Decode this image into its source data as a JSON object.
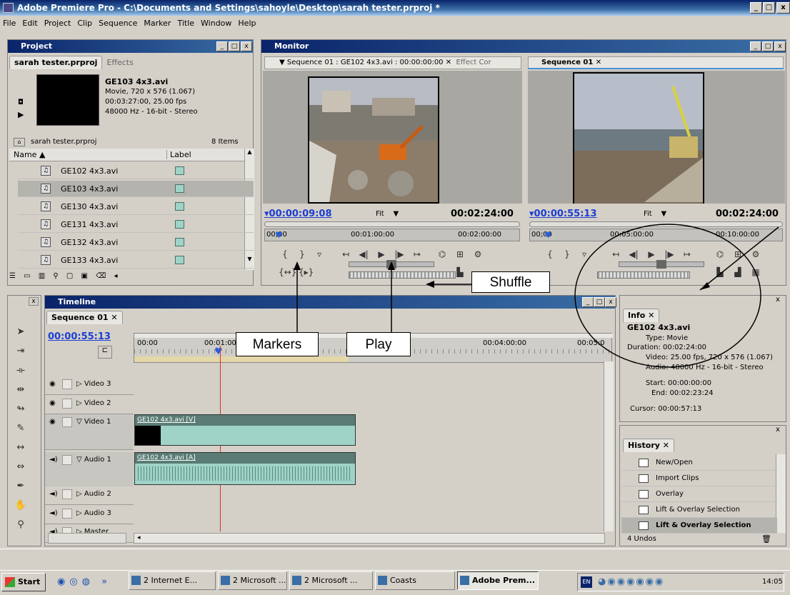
{
  "window": {
    "title": "Adobe Premiere Pro - C:\\Documents and Settings\\sahoyle\\Desktop\\sarah tester.prproj *",
    "min": "_",
    "max": "□",
    "close": "x"
  },
  "menu": [
    "File",
    "Edit",
    "Project",
    "Clip",
    "Sequence",
    "Marker",
    "Title",
    "Window",
    "Help"
  ],
  "project": {
    "title": "Project",
    "tab_active": "sarah tester.prproj",
    "tab_other": "Effects",
    "clip_name": "GE103 4x3.avi",
    "clip_line1": "Movie, 720 x 576 (1.067)",
    "clip_line2": "00:03:27:00, 25.00 fps",
    "clip_line3": "48000 Hz - 16-bit - Stereo",
    "project_name": "sarah tester.prproj",
    "item_count": "8 Items",
    "col_name": "Name",
    "col_label": "Label",
    "items": [
      "GE102 4x3.avi",
      "GE103 4x3.avi",
      "GE130 4x3.avi",
      "GE131 4x3.avi",
      "GE132 4x3.avi",
      "GE133 4x3.avi"
    ]
  },
  "monitor": {
    "title": "Monitor",
    "source_tab": "Sequence 01 : GE102 4x3.avi : 00:00:00:00",
    "effect_tab": "Effect Cor",
    "program_tab": "Sequence 01",
    "source_time": "00:00:09:08",
    "source_fit": "Fit",
    "source_dur": "00:02:24:00",
    "source_ruler": [
      "00;00",
      "00:01:00:00",
      "00:02:00:00"
    ],
    "program_time": "00:00:55:13",
    "program_fit": "Fit",
    "program_dur": "00:02:24:00",
    "program_ruler": [
      "00;00",
      "00:05:00:00",
      "00:10:00:00"
    ]
  },
  "callouts": {
    "shuffle": "Shuffle",
    "markers": "Markers",
    "play": "Play"
  },
  "timeline": {
    "title": "Timeline",
    "tab": "Sequence 01",
    "time": "00:00:55:13",
    "ruler": [
      "00:00",
      "00:01:00",
      "00:04:00:00",
      "00:05:0"
    ],
    "tracks": [
      "Video 3",
      "Video 2",
      "Video 1",
      "Audio 1",
      "Audio 2",
      "Audio 3",
      "Master"
    ],
    "video_clip": "GE102 4x3.avi [V]",
    "audio_clip": "GE102 4x3.avi [A]"
  },
  "info": {
    "tab": "Info",
    "clip": "GE102 4x3.avi",
    "type": "Type: Movie",
    "duration": "Duration: 00:02:24:00",
    "video": "Video: 25.00 fps, 720 x 576 (1.067)",
    "audio": "Audio: 48000 Hz - 16-bit - Stereo",
    "start": "Start: 00:00:00:00",
    "end": "End: 00:02:23:24",
    "cursor": "Cursor: 00:00:57:13"
  },
  "history": {
    "tab": "History",
    "items": [
      "New/Open",
      "Import Clips",
      "Overlay",
      "Lift & Overlay Selection",
      "Lift & Overlay Selection"
    ],
    "undos": "4 Undos"
  },
  "taskbar": {
    "start": "Start",
    "items": [
      "2 Internet E...",
      "2 Microsoft ...",
      "2 Microsoft ...",
      "Coasts",
      "Adobe Prem..."
    ],
    "lang": "EN",
    "clock": "14:05"
  }
}
